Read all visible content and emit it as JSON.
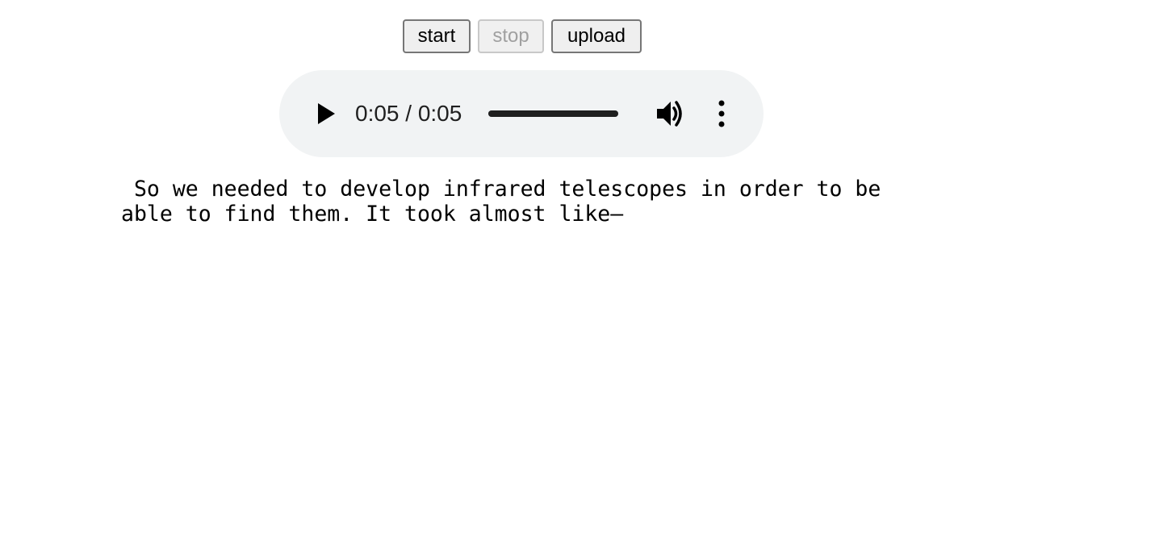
{
  "controls": {
    "start_label": "start",
    "stop_label": "stop",
    "upload_label": "upload",
    "stop_disabled": true
  },
  "audio": {
    "time_display": "0:05 / 0:05",
    "current_time": "0:05",
    "duration": "0:05",
    "progress": 1.0,
    "state": "paused",
    "icons": [
      "play-icon",
      "volume-icon",
      "more-options-icon"
    ]
  },
  "transcript": {
    "text": " So we needed to develop infrared telescopes in order to be\nable to find them. It took almost like—"
  }
}
